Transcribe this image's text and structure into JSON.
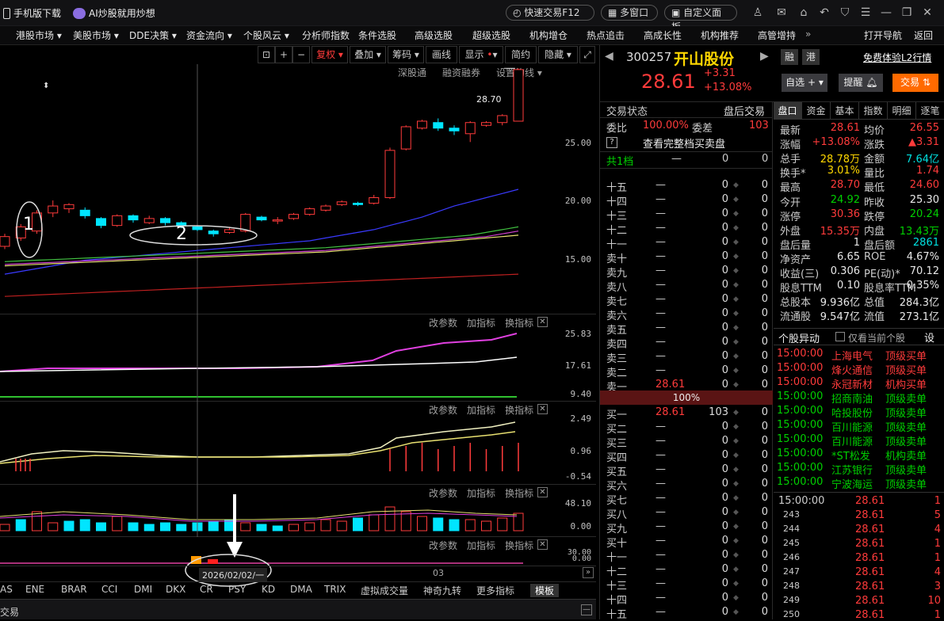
{
  "titlebar": {
    "mobile_download": "手机版下载",
    "ai_promo": "AI炒股就用炒想",
    "quick_trade": "快速交易F12",
    "multi_window": "多窗口",
    "custom_panel": "自定义面板"
  },
  "nav": {
    "items": [
      "港股市场 ▾",
      "美股市场 ▾",
      "DDE决策 ▾",
      "资金流向 ▾",
      "个股风云 ▾",
      "分析师指数",
      "条件选股",
      "高级选股",
      "超级选股",
      "机构增仓",
      "热点追击",
      "高成长性",
      "机构推荐",
      "高管增持"
    ],
    "more": "»",
    "open_nav": "打开导航",
    "back": "返回"
  },
  "chart_toolbar": {
    "buttons": [
      "复权",
      "叠加",
      "筹码",
      "画线",
      "显示",
      "简约",
      "隐藏"
    ],
    "sublinks": [
      "深股通",
      "融资融券",
      "设置均线 ▾"
    ]
  },
  "main_chart": {
    "y_ticks": [
      "25.00",
      "20.00",
      "15.00"
    ],
    "price_tag": "28.70",
    "annotation_1": "1",
    "annotation_2": "2"
  },
  "indicator_controls": [
    "改参数",
    "加指标",
    "换指标"
  ],
  "indicator1": {
    "y_ticks": [
      "25.83",
      "17.61",
      "9.40"
    ]
  },
  "indicator2": {
    "y_ticks": [
      "2.49",
      "0.96",
      "-0.54"
    ]
  },
  "indicator3": {
    "y_ticks": [
      "48.10",
      "0.00"
    ]
  },
  "indicator4": {
    "y_ticks": [
      "30.00",
      "0.00"
    ]
  },
  "date_bar": {
    "date": "2026/02/02/一",
    "x_label": "03"
  },
  "indicator_tabs": [
    "AS",
    "ENE",
    "BRAR",
    "CCI",
    "DMI",
    "DKX",
    "CR",
    "PSY",
    "KD",
    "DMA",
    "TRIX",
    "虚拟成交量",
    "神奇九转",
    "更多指标",
    "模板"
  ],
  "bottom_bar": {
    "label": "交易"
  },
  "chart_data": {
    "type": "candlestick",
    "ylim": [
      11,
      29
    ],
    "candles": [
      {
        "o": 15.9,
        "c": 16.6,
        "h": 16.8,
        "l": 15.7
      },
      {
        "o": 16.5,
        "c": 17.3,
        "h": 17.5,
        "l": 16.3
      },
      {
        "o": 17.0,
        "c": 18.3,
        "h": 18.5,
        "l": 16.8
      },
      {
        "o": 18.3,
        "c": 18.8,
        "h": 19.2,
        "l": 18.0
      },
      {
        "o": 18.6,
        "c": 18.9,
        "h": 19.0,
        "l": 18.3
      },
      {
        "o": 18.5,
        "c": 18.1,
        "h": 18.7,
        "l": 17.9
      },
      {
        "o": 17.9,
        "c": 17.4,
        "h": 18.0,
        "l": 17.2
      },
      {
        "o": 17.4,
        "c": 18.1,
        "h": 18.2,
        "l": 17.3
      },
      {
        "o": 18.1,
        "c": 17.8,
        "h": 18.2,
        "l": 17.6
      },
      {
        "o": 17.6,
        "c": 17.9,
        "h": 18.1,
        "l": 17.5
      },
      {
        "o": 17.9,
        "c": 17.6,
        "h": 18.0,
        "l": 17.4
      },
      {
        "o": 17.6,
        "c": 17.4,
        "h": 17.7,
        "l": 17.2
      },
      {
        "o": 17.3,
        "c": 17.1,
        "h": 17.4,
        "l": 17.0
      },
      {
        "o": 17.0,
        "c": 16.8,
        "h": 17.1,
        "l": 16.6
      },
      {
        "o": 16.9,
        "c": 17.1,
        "h": 17.3,
        "l": 16.8
      },
      {
        "o": 17.0,
        "c": 18.2,
        "h": 18.3,
        "l": 16.9
      },
      {
        "o": 18.0,
        "c": 17.8,
        "h": 18.1,
        "l": 17.7
      },
      {
        "o": 17.8,
        "c": 17.8,
        "h": 18.0,
        "l": 17.5
      },
      {
        "o": 17.9,
        "c": 18.2,
        "h": 18.3,
        "l": 17.8
      },
      {
        "o": 18.2,
        "c": 18.6,
        "h": 18.7,
        "l": 18.1
      },
      {
        "o": 18.5,
        "c": 18.8,
        "h": 18.9,
        "l": 18.4
      },
      {
        "o": 18.9,
        "c": 19.1,
        "h": 19.2,
        "l": 18.8
      },
      {
        "o": 19.0,
        "c": 18.9,
        "h": 19.1,
        "l": 18.8
      },
      {
        "o": 19.0,
        "c": 19.4,
        "h": 19.6,
        "l": 18.9
      },
      {
        "o": 19.4,
        "c": 22.8,
        "h": 23.0,
        "l": 19.3
      },
      {
        "o": 22.9,
        "c": 24.5,
        "h": 24.6,
        "l": 22.8
      },
      {
        "o": 24.4,
        "c": 24.9,
        "h": 25.0,
        "l": 24.3
      },
      {
        "o": 24.8,
        "c": 24.4,
        "h": 25.1,
        "l": 24.2
      },
      {
        "o": 24.4,
        "c": 24.2,
        "h": 24.6,
        "l": 23.9
      },
      {
        "o": 24.0,
        "c": 24.8,
        "h": 24.9,
        "l": 23.4
      },
      {
        "o": 24.6,
        "c": 24.8,
        "h": 24.9,
        "l": 24.5
      },
      {
        "o": 24.8,
        "c": 25.3,
        "h": 25.4,
        "l": 24.6
      },
      {
        "o": 24.9,
        "c": 28.61,
        "h": 28.7,
        "l": 24.9
      }
    ],
    "ma": [
      {
        "color": "#3a3aff",
        "values": [
          13.9,
          14.1,
          14.3,
          14.5,
          14.7,
          14.9,
          15.0,
          15.1,
          15.2,
          15.3,
          15.4,
          15.5,
          15.6,
          15.7,
          15.8,
          15.9,
          16.0,
          16.1,
          16.2,
          16.3,
          16.5,
          16.7,
          16.9,
          17.1,
          17.4,
          17.7,
          18.0,
          18.4,
          18.8,
          19.1,
          19.4,
          19.7,
          20.0
        ]
      },
      {
        "color": "#40c040",
        "values": [
          14.8,
          14.85,
          14.9,
          14.95,
          15.0,
          15.05,
          15.1,
          15.15,
          15.2,
          15.25,
          15.3,
          15.35,
          15.4,
          15.45,
          15.5,
          15.55,
          15.6,
          15.65,
          15.7,
          15.75,
          15.8,
          15.9,
          16.0,
          16.1,
          16.2,
          16.3,
          16.4,
          16.5,
          16.6,
          16.7,
          16.9,
          17.1,
          17.3
        ]
      },
      {
        "color": "#d040d0",
        "values": [
          14.6,
          14.65,
          14.7,
          14.75,
          14.8,
          14.85,
          14.9,
          14.95,
          15.0,
          15.05,
          15.1,
          15.15,
          15.2,
          15.25,
          15.3,
          15.35,
          15.4,
          15.45,
          15.5,
          15.55,
          15.6,
          15.7,
          15.8,
          15.9,
          16.0,
          16.1,
          16.2,
          16.3,
          16.4,
          16.5,
          16.6,
          16.8,
          17.0
        ]
      },
      {
        "color": "#e8e070",
        "values": [
          14.5,
          14.55,
          14.6,
          14.65,
          14.7,
          14.75,
          14.8,
          14.85,
          14.9,
          14.95,
          15.0,
          15.05,
          15.1,
          15.15,
          15.2,
          15.25,
          15.3,
          15.35,
          15.4,
          15.45,
          15.5,
          15.6,
          15.7,
          15.8,
          15.9,
          16.0,
          16.1,
          16.2,
          16.3,
          16.4,
          16.5,
          16.6,
          16.7
        ]
      },
      {
        "color": "#c02020",
        "values": [
          12.3,
          12.35,
          12.4,
          12.45,
          12.5,
          12.55,
          12.6,
          12.65,
          12.7,
          12.75,
          12.8,
          12.85,
          12.9,
          12.95,
          13.0,
          13.05,
          13.1,
          13.15,
          13.2,
          13.25,
          13.3,
          13.35,
          13.4,
          13.45,
          13.5,
          13.55,
          13.6,
          13.65,
          13.7,
          13.75,
          13.8,
          13.85,
          13.9
        ]
      }
    ]
  },
  "stock": {
    "code": "300257",
    "name": "开山股份",
    "tag_rong": "融",
    "tag_gang": "港",
    "l2_link": "免费体验L2行情",
    "price": "28.61",
    "change": "+3.31",
    "change_pct": "+13.08%",
    "watchlist_btn": "自选 +",
    "alert_btn": "提醒",
    "trade_btn": "交易"
  },
  "orderbook": {
    "status_label": "交易状态",
    "status_value": "盘后交易",
    "weibi_label": "委比",
    "weibi_value": "100.00%",
    "weicha_label": "委差",
    "weicha_value": "103",
    "help_icon": "?",
    "full_book": "查看完整档买卖盘",
    "total_label": "共1档",
    "asks": [
      {
        "label": "十五",
        "price": "—",
        "vol": "0",
        "cnt": "0"
      },
      {
        "label": "十四",
        "price": "—",
        "vol": "0",
        "cnt": "0"
      },
      {
        "label": "十三",
        "price": "—",
        "vol": "0",
        "cnt": "0"
      },
      {
        "label": "十二",
        "price": "—",
        "vol": "0",
        "cnt": "0"
      },
      {
        "label": "十一",
        "price": "—",
        "vol": "0",
        "cnt": "0"
      },
      {
        "label": "卖十",
        "price": "—",
        "vol": "0",
        "cnt": "0"
      },
      {
        "label": "卖九",
        "price": "—",
        "vol": "0",
        "cnt": "0"
      },
      {
        "label": "卖八",
        "price": "—",
        "vol": "0",
        "cnt": "0"
      },
      {
        "label": "卖七",
        "price": "—",
        "vol": "0",
        "cnt": "0"
      },
      {
        "label": "卖六",
        "price": "—",
        "vol": "0",
        "cnt": "0"
      },
      {
        "label": "卖五",
        "price": "—",
        "vol": "0",
        "cnt": "0"
      },
      {
        "label": "卖四",
        "price": "—",
        "vol": "0",
        "cnt": "0"
      },
      {
        "label": "卖三",
        "price": "—",
        "vol": "0",
        "cnt": "0"
      },
      {
        "label": "卖二",
        "price": "—",
        "vol": "0",
        "cnt": "0"
      },
      {
        "label": "卖一",
        "price": "28.61",
        "vol": "0",
        "cnt": "0"
      }
    ],
    "ratio": "100%",
    "bids": [
      {
        "label": "买一",
        "price": "28.61",
        "vol": "103",
        "cnt": "0"
      },
      {
        "label": "买二",
        "price": "—",
        "vol": "0",
        "cnt": "0"
      },
      {
        "label": "买三",
        "price": "—",
        "vol": "0",
        "cnt": "0"
      },
      {
        "label": "买四",
        "price": "—",
        "vol": "0",
        "cnt": "0"
      },
      {
        "label": "买五",
        "price": "—",
        "vol": "0",
        "cnt": "0"
      },
      {
        "label": "买六",
        "price": "—",
        "vol": "0",
        "cnt": "0"
      },
      {
        "label": "买七",
        "price": "—",
        "vol": "0",
        "cnt": "0"
      },
      {
        "label": "买八",
        "price": "—",
        "vol": "0",
        "cnt": "0"
      },
      {
        "label": "买九",
        "price": "—",
        "vol": "0",
        "cnt": "0"
      },
      {
        "label": "买十",
        "price": "—",
        "vol": "0",
        "cnt": "0"
      },
      {
        "label": "十一",
        "price": "—",
        "vol": "0",
        "cnt": "0"
      },
      {
        "label": "十二",
        "price": "—",
        "vol": "0",
        "cnt": "0"
      },
      {
        "label": "十三",
        "price": "—",
        "vol": "0",
        "cnt": "0"
      },
      {
        "label": "十四",
        "price": "—",
        "vol": "0",
        "cnt": "0"
      },
      {
        "label": "十五",
        "price": "—",
        "vol": "0",
        "cnt": "0"
      }
    ]
  },
  "quote_tabs": [
    "盘口",
    "资金",
    "基本",
    "指数",
    "明细",
    "逐笔"
  ],
  "quote": [
    {
      "l1": "最新",
      "v1": "28.61",
      "c1": "red",
      "l2": "均价",
      "v2": "26.55",
      "c2": "red"
    },
    {
      "l1": "涨幅",
      "v1": "+13.08%",
      "c1": "red",
      "l2": "涨跌",
      "v2": "▲3.31",
      "c2": "red"
    },
    {
      "l1": "总手",
      "v1": "28.78万",
      "c1": "yellow",
      "l2": "金额",
      "v2": "7.64亿",
      "c2": "cyan"
    },
    {
      "l1": "换手*",
      "v1": "3.01%",
      "c1": "yellow",
      "l2": "量比",
      "v2": "1.74",
      "c2": "red"
    },
    {
      "l1": "最高",
      "v1": "28.70",
      "c1": "red",
      "l2": "最低",
      "v2": "24.60",
      "c2": "red"
    },
    {
      "l1": "今开",
      "v1": "24.92",
      "c1": "green",
      "l2": "昨收",
      "v2": "25.30",
      "c2": "white"
    },
    {
      "l1": "涨停",
      "v1": "30.36",
      "c1": "red",
      "l2": "跌停",
      "v2": "20.24",
      "c2": "green"
    },
    {
      "l1": "外盘",
      "v1": "15.35万",
      "c1": "red",
      "l2": "内盘",
      "v2": "13.43万",
      "c2": "green"
    },
    {
      "l1": "盘后量",
      "v1": "1",
      "c1": "white",
      "l2": "盘后额",
      "v2": "2861",
      "c2": "cyan"
    },
    {
      "l1": "净资产",
      "v1": "6.65",
      "c1": "white",
      "l2": "ROE",
      "v2": "4.67%",
      "c2": "white"
    },
    {
      "l1": "收益(三)",
      "v1": "0.306",
      "c1": "white",
      "l2": "PE(动)*",
      "v2": "70.12",
      "c2": "white"
    },
    {
      "l1": "股息TTM",
      "v1": "0.10",
      "c1": "white",
      "l2": "股息率TTM",
      "v2": "0.35%",
      "c2": "white"
    },
    {
      "l1": "总股本",
      "v1": "9.936亿",
      "c1": "white",
      "l2": "总值",
      "v2": "284.3亿",
      "c2": "white"
    },
    {
      "l1": "流通股",
      "v1": "9.547亿",
      "c1": "white",
      "l2": "流值",
      "v2": "273.1亿",
      "c2": "white"
    }
  ],
  "events": {
    "title": "个股异动",
    "checkbox_label": "仅看当前个股",
    "settings": "设",
    "rows": [
      {
        "time": "15:00:00",
        "name": "上海电气",
        "type": "顶级买单",
        "c": "red"
      },
      {
        "time": "15:00:00",
        "name": "烽火通信",
        "type": "顶级买单",
        "c": "red"
      },
      {
        "time": "15:00:00",
        "name": "永冠新材",
        "type": "机构买单",
        "c": "red"
      },
      {
        "time": "15:00:00",
        "name": "招商南油",
        "type": "顶级卖单",
        "c": "green"
      },
      {
        "time": "15:00:00",
        "name": "哈投股份",
        "type": "顶级卖单",
        "c": "green"
      },
      {
        "time": "15:00:00",
        "name": "百川能源",
        "type": "顶级卖单",
        "c": "green"
      },
      {
        "time": "15:00:00",
        "name": "百川能源",
        "type": "顶级卖单",
        "c": "green"
      },
      {
        "time": "15:00:00",
        "name": "*ST松发",
        "type": "机构卖单",
        "c": "green"
      },
      {
        "time": "15:00:00",
        "name": "江苏银行",
        "type": "顶级卖单",
        "c": "green"
      },
      {
        "time": "15:00:00",
        "name": "宁波海运",
        "type": "顶级卖单",
        "c": "green"
      }
    ]
  },
  "ticks": [
    {
      "t": "15:00:00",
      "p": "28.61",
      "v": "1"
    },
    {
      "t": "243",
      "p": "28.61",
      "v": "5"
    },
    {
      "t": "244",
      "p": "28.61",
      "v": "4"
    },
    {
      "t": "245",
      "p": "28.61",
      "v": "1"
    },
    {
      "t": "246",
      "p": "28.61",
      "v": "1"
    },
    {
      "t": "247",
      "p": "28.61",
      "v": "4"
    },
    {
      "t": "248",
      "p": "28.61",
      "v": "3"
    },
    {
      "t": "249",
      "p": "28.61",
      "v": "10"
    },
    {
      "t": "250",
      "p": "28.61",
      "v": "1"
    }
  ]
}
